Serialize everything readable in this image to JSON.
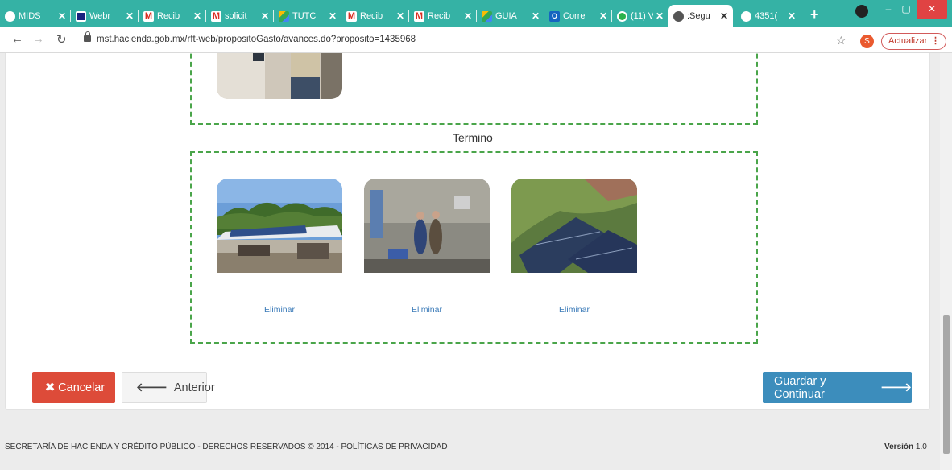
{
  "browser": {
    "tabs": [
      {
        "title": "MIDS",
        "fav_color": "#ffffff",
        "fav_shape": "globe-icon"
      },
      {
        "title": "Webr",
        "fav_color": "#1a237e",
        "fav_shape": "webex-icon"
      },
      {
        "title": "Recib",
        "fav_color": "#ffffff",
        "fav_shape": "gmail-icon"
      },
      {
        "title": "solicit",
        "fav_color": "#ffffff",
        "fav_shape": "gmail-icon"
      },
      {
        "title": "TUTC",
        "fav_color": "#ffffff",
        "fav_shape": "drive-icon"
      },
      {
        "title": "Recib",
        "fav_color": "#ffffff",
        "fav_shape": "gmail-icon"
      },
      {
        "title": "Recib",
        "fav_color": "#ffffff",
        "fav_shape": "gmail-icon"
      },
      {
        "title": "GUIA",
        "fav_color": "#ffffff",
        "fav_shape": "drive-icon"
      },
      {
        "title": "Corre",
        "fav_color": "#1565c0",
        "fav_shape": "outlook-icon"
      },
      {
        "title": "(11) V",
        "fav_color": "#2bb24c",
        "fav_shape": "whatsapp-icon"
      },
      {
        "title": ":Segu",
        "fav_color": "#ffffff",
        "fav_shape": "globe-icon"
      },
      {
        "title": "4351(",
        "fav_color": "#ffffff",
        "fav_shape": "globe-icon"
      }
    ],
    "new_tab": "+",
    "url": "mst.hacienda.gob.mx/rft-web/propositoGasto/avances.do?proposito=1435968",
    "profile_initial": "S",
    "update_label": "Actualizar",
    "colors": {
      "tabstrip": "#35b2a5",
      "update": "#c0392b"
    }
  },
  "content": {
    "section_label": "Termino",
    "photos": [
      {
        "alt": "Paneles solares sobre techo de lámina",
        "delete_label": "Eliminar"
      },
      {
        "alt": "Dos personas junto a la instalación",
        "delete_label": "Eliminar"
      },
      {
        "alt": "Paneles solares en techo",
        "delete_label": "Eliminar"
      }
    ],
    "buttons": {
      "cancel": "Cancelar",
      "previous": "Anterior",
      "save_continue": "Guardar y Continuar"
    },
    "colors": {
      "dashed_border": "#4aa54a",
      "cancel": "#dd4b39",
      "save": "#3c8dbc",
      "link": "#3a7ab8"
    }
  },
  "footer": {
    "text": "SECRETARÍA DE HACIENDA Y CRÉDITO PÚBLICO - DERECHOS RESERVADOS © 2014 - POLÍTICAS DE PRIVACIDAD",
    "version_label": "Versión",
    "version_number": "1.0"
  }
}
